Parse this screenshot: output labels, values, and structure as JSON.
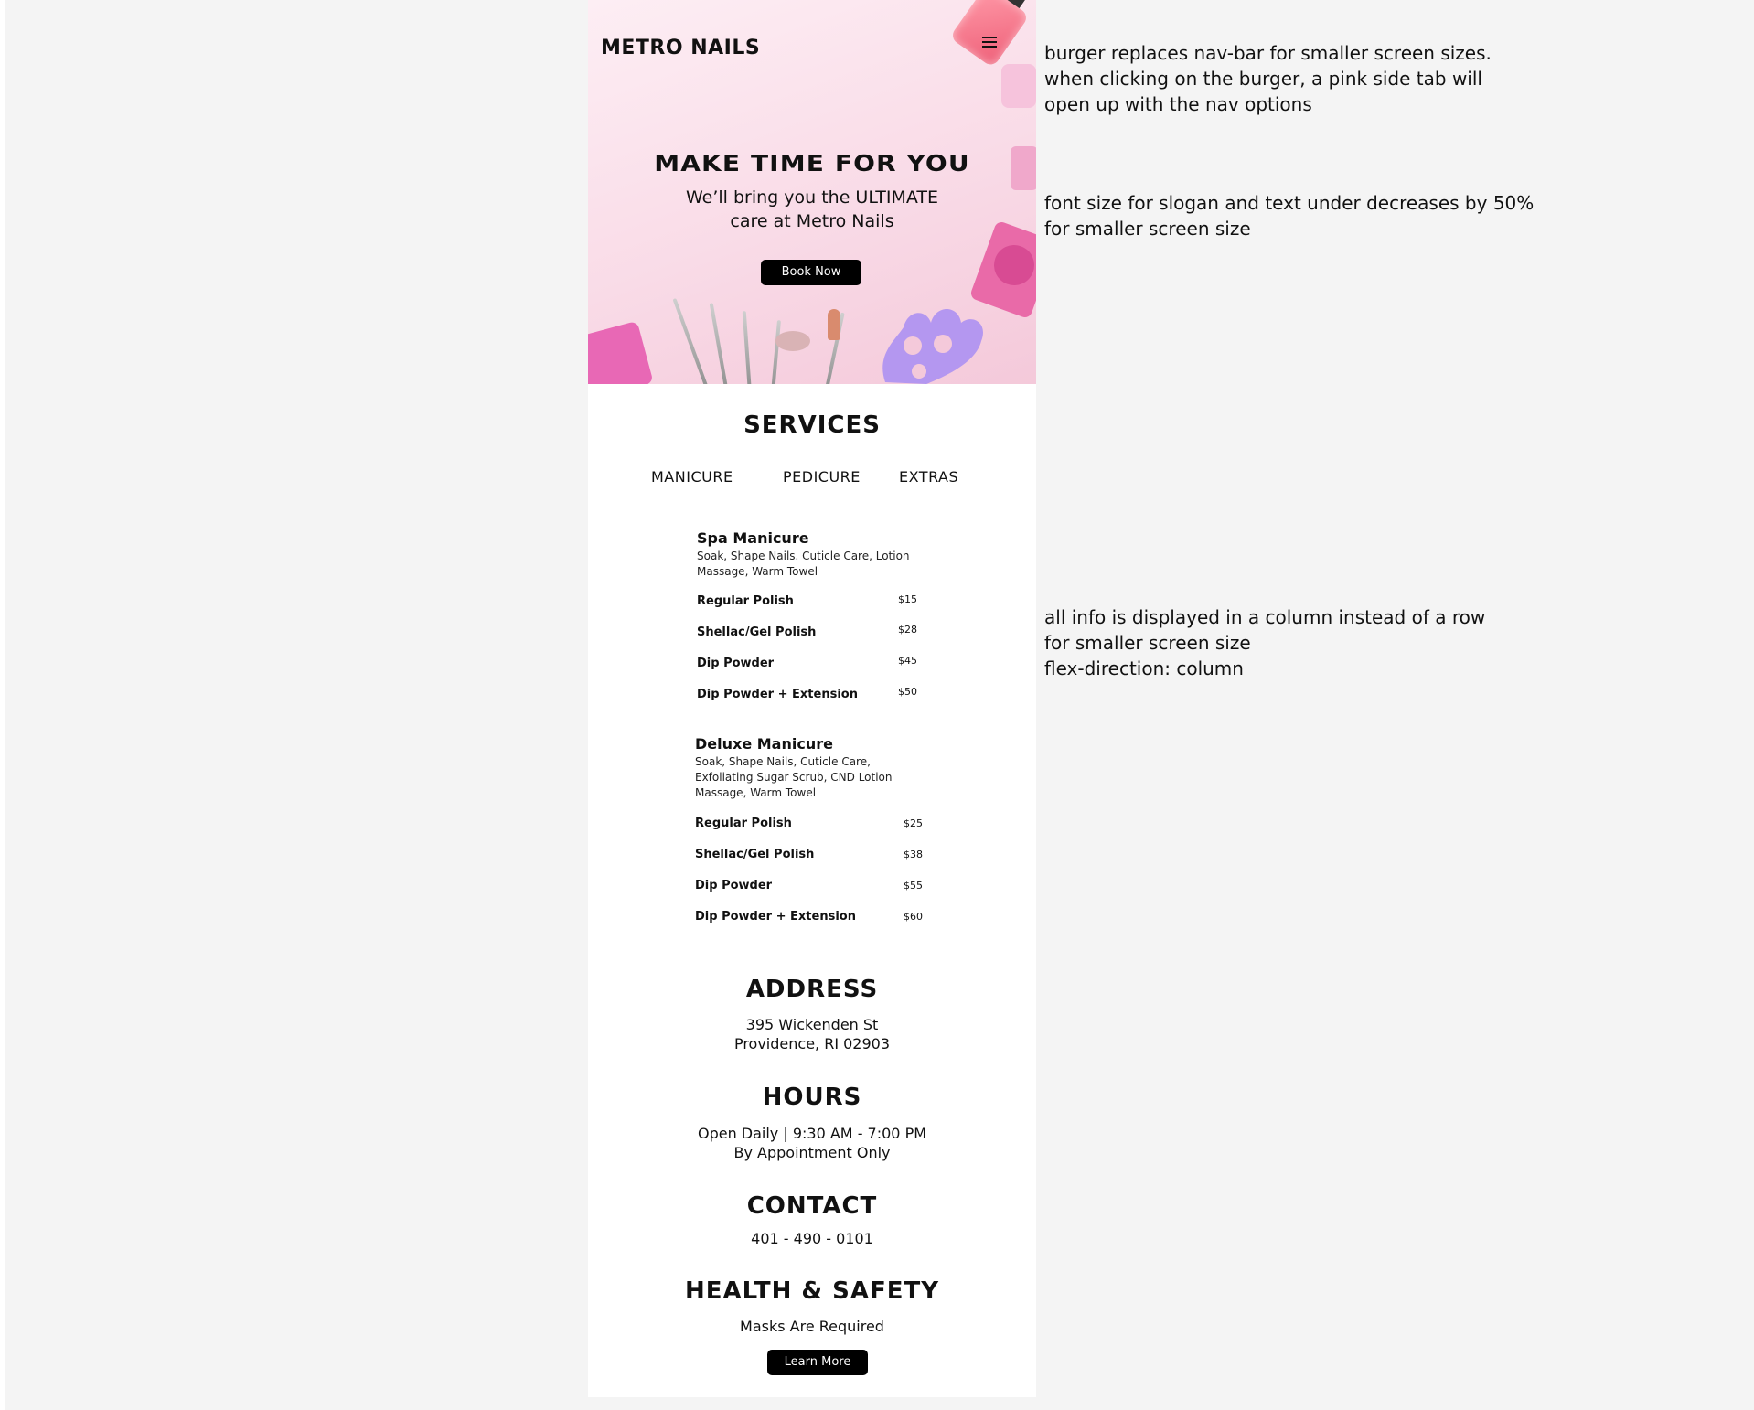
{
  "brand": "METRO NAILS",
  "hero": {
    "slogan": "MAKE TIME FOR YOU",
    "subtext_line1": "We’ll bring you the ULTIMATE",
    "subtext_line2": "care at Metro Nails",
    "book_button": "Book Now"
  },
  "services": {
    "title": "SERVICES",
    "tabs": [
      {
        "label": "MANICURE",
        "active": true
      },
      {
        "label": "PEDICURE",
        "active": false
      },
      {
        "label": "EXTRAS",
        "active": false
      }
    ],
    "items": [
      {
        "name": "Spa Manicure",
        "desc_line1": "Soak, Shape Nails. Cuticle Care, Lotion",
        "desc_line2": "Massage, Warm Towel",
        "desc_line3": "",
        "options": [
          {
            "label": "Regular Polish",
            "price": "$15"
          },
          {
            "label": "Shellac/Gel Polish",
            "price": "$28"
          },
          {
            "label": "Dip Powder",
            "price": "$45"
          },
          {
            "label": "Dip Powder + Extension",
            "price": "$50"
          }
        ]
      },
      {
        "name": "Deluxe Manicure",
        "desc_line1": "Soak, Shape Nails, Cuticle Care,",
        "desc_line2": "Exfoliating Sugar Scrub, CND Lotion",
        "desc_line3": "Massage, Warm Towel",
        "options": [
          {
            "label": "Regular Polish",
            "price": "$25"
          },
          {
            "label": "Shellac/Gel Polish",
            "price": "$38"
          },
          {
            "label": "Dip Powder",
            "price": "$55"
          },
          {
            "label": "Dip Powder + Extension",
            "price": "$60"
          }
        ]
      }
    ]
  },
  "address": {
    "title": "ADDRESS",
    "line1": "395 Wickenden St",
    "line2": "Providence, RI 02903"
  },
  "hours": {
    "title": "HOURS",
    "line1": "Open Daily | 9:30 AM - 7:00 PM",
    "line2": "By Appointment Only"
  },
  "contact": {
    "title": "CONTACT",
    "phone": "401 - 490 - 0101"
  },
  "health": {
    "title": "HEALTH & SAFETY",
    "line1": "Masks Are Required",
    "button": "Learn More"
  },
  "annotations": {
    "burger": [
      "burger replaces nav-bar for smaller screen sizes.",
      "when clicking on the burger, a pink side tab will",
      "open up with the nav options"
    ],
    "font": [
      "font size for slogan and text under decreases by 50%",
      "for smaller screen size"
    ],
    "column": [
      "all info is displayed in a column instead of  a row",
      "for smaller screen size",
      "flex-direction: column"
    ]
  },
  "colors": {
    "accent": "#e0589b",
    "button": "#000000",
    "page_bg": "#f4f4f4",
    "hero_pink": "#f9dbe7"
  }
}
